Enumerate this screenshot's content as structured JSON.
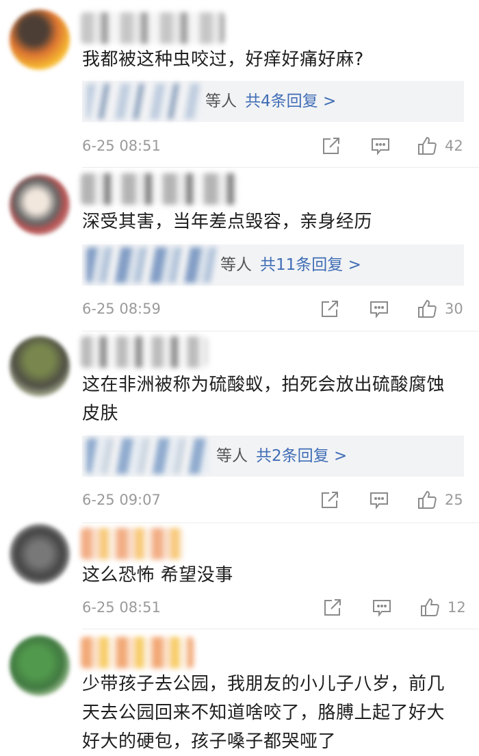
{
  "comments": [
    {
      "text": "我都被这种虫咬过，好痒好痛好麻?",
      "reply": {
        "people": "等人",
        "count": "共4条回复 >"
      },
      "time": "6-25 08:51",
      "likes": "42"
    },
    {
      "text": "深受其害，当年差点毁容，亲身经历",
      "reply": {
        "people": "等人",
        "count": "共11条回复 >"
      },
      "time": "6-25 08:59",
      "likes": "30"
    },
    {
      "text": "这在非洲被称为硫酸蚁，拍死会放出硫酸腐蚀皮肤",
      "reply": {
        "people": "等人",
        "count": "共2条回复 >"
      },
      "time": "6-25 09:07",
      "likes": "25"
    },
    {
      "text": "这么恐怖 希望没事",
      "time": "6-25 08:51",
      "likes": "12"
    },
    {
      "text": "少带孩子去公园，我朋友的小儿子八岁，前几天去公园回来不知道啥咬了，胳膊上起了好大好大的硬包，孩子嗓子都哭哑了"
    }
  ],
  "icons": {
    "share": "share-icon",
    "comment": "comment-icon",
    "like": "thumbs-up-icon"
  }
}
